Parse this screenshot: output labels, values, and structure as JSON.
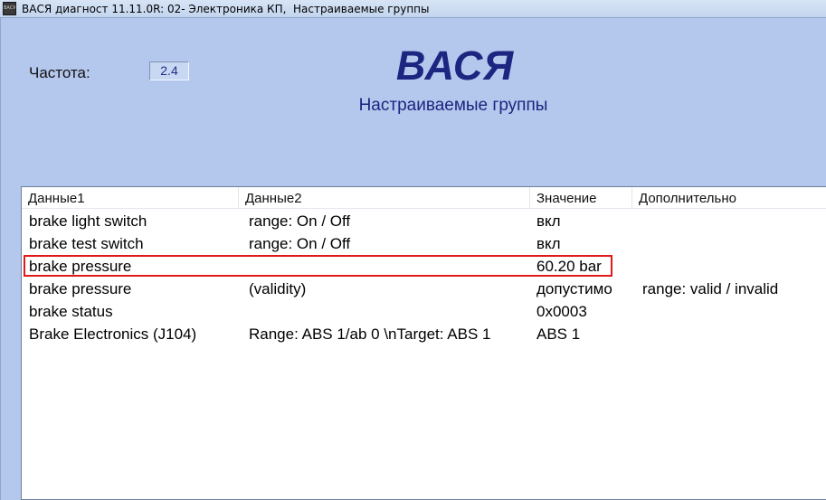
{
  "window": {
    "icon_text": "ВАСЯ",
    "title": "ВАСЯ диагност 11.11.0R: 02- Электроника КП,  Настраиваемые группы"
  },
  "header": {
    "frequency_label": "Частота:",
    "frequency_value": "2.4",
    "brand": "ВАСЯ",
    "subtitle": "Настраиваемые группы"
  },
  "table": {
    "columns": [
      "Данные1",
      "Данные2",
      "Значение",
      "Дополнительно"
    ],
    "rows": [
      {
        "d1": "brake light switch",
        "d2": "range: On / Off",
        "value": "вкл",
        "extra": ""
      },
      {
        "d1": "brake test switch",
        "d2": "range: On / Off",
        "value": "вкл",
        "extra": ""
      },
      {
        "d1": "brake pressure",
        "d2": "",
        "value": "60.20 bar",
        "extra": ""
      },
      {
        "d1": "brake pressure",
        "d2": "(validity)",
        "value": "допустимо",
        "extra": "range: valid / invalid"
      },
      {
        "d1": "brake status",
        "d2": "",
        "value": "0x0003",
        "extra": ""
      },
      {
        "d1": "Brake Electronics (J104)",
        "d2": "Range: ABS 1/ab 0 \\nTarget: ABS 1",
        "value": "ABS 1",
        "extra": ""
      }
    ],
    "highlight_color": "#e01a1a"
  }
}
